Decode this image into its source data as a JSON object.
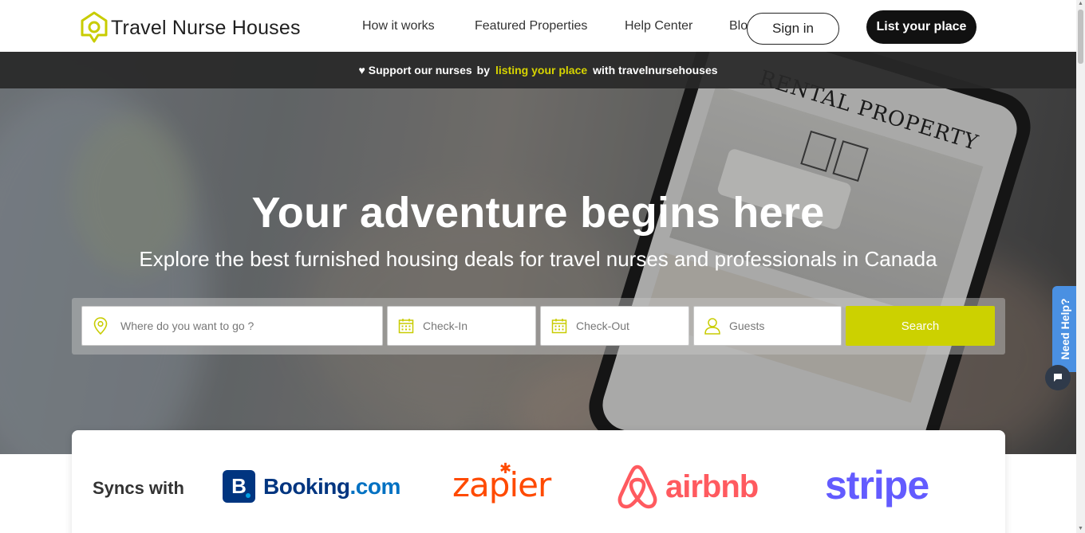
{
  "header": {
    "brand": "Travel Nurse Houses",
    "nav": [
      "How it works",
      "Featured Properties",
      "Help Center",
      "Blog"
    ],
    "sign_in": "Sign in",
    "list_place": "List your place"
  },
  "banner": {
    "heart": "♥",
    "part1": "Support our nurses",
    "part2": "by",
    "highlight": "listing your place",
    "part3": "with travelnursehouses"
  },
  "hero": {
    "title": "Your adventure begins here",
    "subtitle": "Explore the best furnished housing deals for travel nurses and professionals in Canada",
    "phone_screen_text": "RENTAL PROPERTY"
  },
  "search": {
    "where_placeholder": "Where do you want to go ?",
    "checkin_placeholder": "Check-In",
    "checkout_placeholder": "Check-Out",
    "guests_placeholder": "Guests",
    "button": "Search"
  },
  "syncs": {
    "label": "Syncs with",
    "partners": {
      "booking_mark": "B",
      "booking_name": "Booking",
      "booking_tld": ".com",
      "zapier": "zapier",
      "airbnb": "airbnb",
      "stripe": "stripe"
    }
  },
  "help_widget": {
    "label": "Need Help?"
  },
  "colors": {
    "accent": "#ccd100",
    "banner_highlight": "#d7d400",
    "dark_button": "#111111",
    "help_blue": "#4a90e2"
  },
  "icons": [
    "logo-house-icon",
    "location-pin-icon",
    "calendar-icon",
    "user-icon",
    "chat-icon",
    "airbnb-icon"
  ]
}
